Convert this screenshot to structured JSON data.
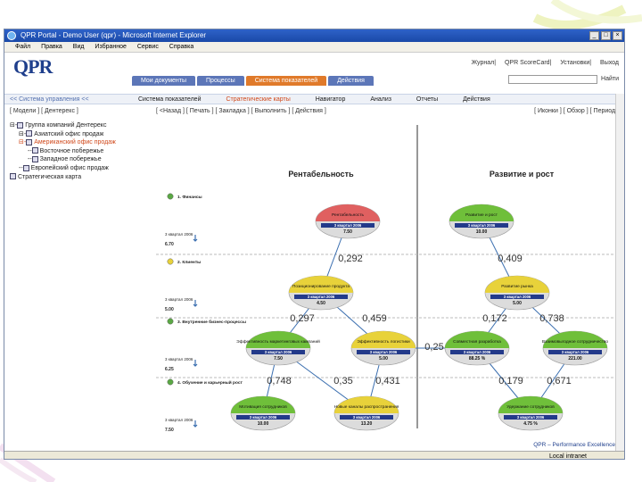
{
  "window": {
    "title": "QPR Portal - Demo User (qpr) - Microsoft Internet Explorer"
  },
  "menu": [
    "Файл",
    "Правка",
    "Вид",
    "Избранное",
    "Сервис",
    "Справка"
  ],
  "logo": "QPR",
  "toplinks": [
    "Журнал",
    "QPR ScoreCard",
    "Установки",
    "Выход"
  ],
  "tabs": [
    {
      "label": "Мои документы"
    },
    {
      "label": "Процессы"
    },
    {
      "label": "Система показателей",
      "active": true
    },
    {
      "label": "Действия"
    }
  ],
  "search_label": "Найти",
  "subnav": {
    "left": "<< Система управления <<",
    "items": [
      "Система показателей",
      "Стратегические карты",
      "Навигатор",
      "Анализ",
      "Отчеты",
      "Действия"
    ]
  },
  "crumbs": "[ Модели ] [ Дентерекс ]",
  "mainlinks": "[ <Назад ] [ Печать ] [ Закладка ] [ Выполнить ] [ Действия ]",
  "rightlinks": "[ Иконки ] [ Обзор ] [ Период ]",
  "tree": [
    {
      "indent": 0,
      "label": "Группа компаний Дентерекс"
    },
    {
      "indent": 1,
      "label": "Азиатский офис продаж"
    },
    {
      "indent": 1,
      "label": "Американский офис продаж",
      "hl": true
    },
    {
      "indent": 1,
      "label": "Восточное побережье"
    },
    {
      "indent": 1,
      "label": "Западное побережье"
    },
    {
      "indent": 1,
      "label": "Европейский офис продаж"
    },
    {
      "indent": 0,
      "label": "Стратегическая карта"
    }
  ],
  "map": {
    "columns": [
      "Рентабельность",
      "Развитие и рост"
    ],
    "rows": [
      {
        "label": "1. Финансы",
        "period": "3 квартал 2006",
        "value": "6.70",
        "color": "#5aa844"
      },
      {
        "label": "2. Клиенты",
        "period": "3 квартал 2006",
        "value": "5.00",
        "color": "#e8d23a"
      },
      {
        "label": "3. Внутренние бизнес-процессы",
        "period": "3 квартал 2006",
        "value": "6.25",
        "color": "#5aa844"
      },
      {
        "label": "4. Обучение и карьерный рост",
        "period": "3 квартал 2006",
        "value": "7.50",
        "color": "#5aa844"
      }
    ],
    "nodes": [
      {
        "id": "n1",
        "title": "Рентабельность",
        "period": "3 квартал 2006",
        "value": "7.50",
        "color": "#e06060"
      },
      {
        "id": "n2",
        "title": "Развитие и рост",
        "period": "3 квартал 2006",
        "value": "10.00",
        "color": "#6fbf3a"
      },
      {
        "id": "n3",
        "title": "Позиционирование продукта",
        "period": "3 квартал 2006",
        "value": "4.50",
        "color": "#e8d23a"
      },
      {
        "id": "n4",
        "title": "Развитие рынка",
        "period": "3 квартал 2006",
        "value": "5.00",
        "color": "#e8d23a"
      },
      {
        "id": "n5",
        "title": "Эффективность маркетинговых кампаний",
        "period": "3 квартал 2006",
        "value": "7.50",
        "color": "#6fbf3a"
      },
      {
        "id": "n6",
        "title": "Эффективность логистики",
        "period": "3 квартал 2006",
        "value": "5.00",
        "color": "#e8d23a"
      },
      {
        "id": "n7",
        "title": "Совместная разработка",
        "period": "3 квартал 2006",
        "value": "88.25 %",
        "color": "#6fbf3a"
      },
      {
        "id": "n8",
        "title": "Взаимовыгодное сотрудничество",
        "period": "3 квартал 2006",
        "value": "221.00",
        "color": "#6fbf3a"
      },
      {
        "id": "n9",
        "title": "Мотивация сотрудников",
        "period": "3 квартал 2006",
        "value": "10.00",
        "color": "#6fbf3a"
      },
      {
        "id": "n10",
        "title": "Новые каналы распространения",
        "period": "3 квартал 2006",
        "value": "13.20",
        "color": "#e8d23a"
      },
      {
        "id": "n11",
        "title": "Удержание сотрудников",
        "period": "3 квартал 2006",
        "value": "4.75 %",
        "color": "#6fbf3a"
      }
    ],
    "links": [
      {
        "label": "0,292"
      },
      {
        "label": "0,409"
      },
      {
        "label": "0,297"
      },
      {
        "label": "0,459"
      },
      {
        "label": "0,172"
      },
      {
        "label": "0,738"
      },
      {
        "label": "0,25"
      },
      {
        "label": "0,748"
      },
      {
        "label": "0,35"
      },
      {
        "label": "0,431"
      },
      {
        "label": "0,179"
      },
      {
        "label": "0,671"
      }
    ]
  },
  "footer": "QPR – Performance Excellence",
  "status": "Local intranet"
}
